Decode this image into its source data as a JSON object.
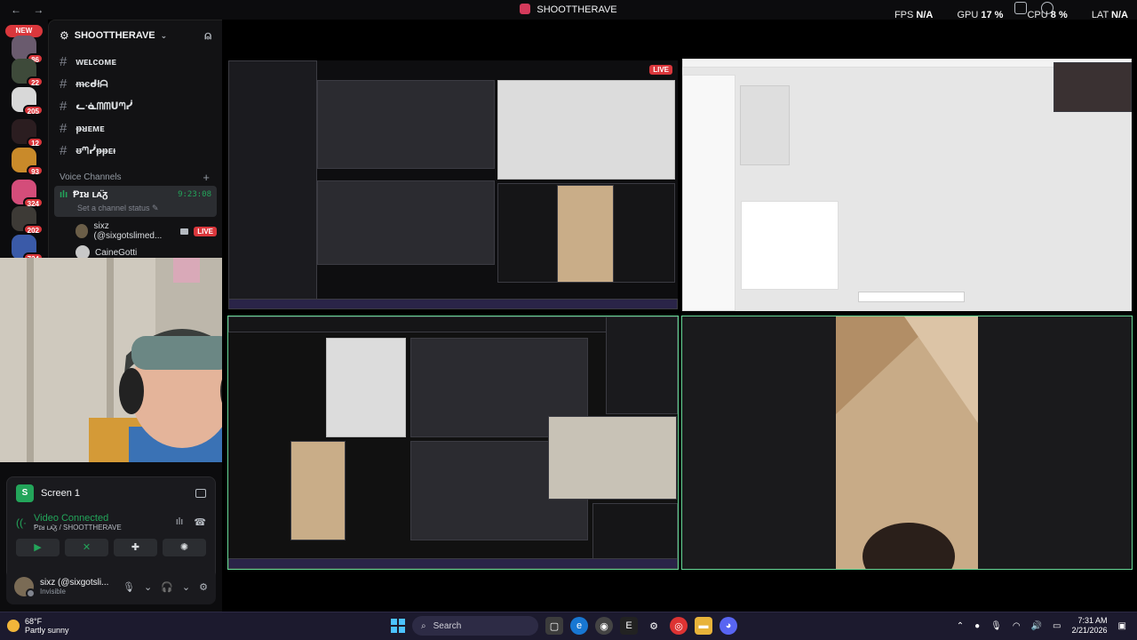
{
  "titlebar": {
    "title": "SHOOTTHERAVE",
    "back": "←",
    "forward": "→"
  },
  "overlay": {
    "fps_label": "FPS",
    "fps_value": "N/A",
    "gpu_label": "GPU",
    "gpu_value": "17 %",
    "cpu_label": "CPU",
    "cpu_value": "8 %",
    "lat_label": "LAT",
    "lat_value": "N/A"
  },
  "rail": {
    "new_label": "NEW",
    "badges": [
      "86",
      "22",
      "205",
      "12",
      "93",
      "324",
      "202",
      "724"
    ]
  },
  "server": {
    "name": "SHOOTTHERAVE",
    "chevron": "⌄",
    "invite": "⍝"
  },
  "channels": [
    {
      "name": "ᴡᴇʟᴄᴏᴍᴇ"
    },
    {
      "name": "ᵯєᑯłᗩ"
    },
    {
      "name": "ᓚᓍᗰᗰᑌᘉᓰ"
    },
    {
      "name": "ᵽᴚᴇᴍᴇ"
    },
    {
      "name": "ᵿᘉᓰᵽᵽᴇᵻ"
    }
  ],
  "voice_category": {
    "label": "Voice Channels",
    "plus": "+"
  },
  "voice_channel": {
    "name": "Ᵽɪᴚ ʟᴀ̈ᵹ",
    "timer": "9:23:08",
    "status": "Set a channel status ✎"
  },
  "voice_users": [
    {
      "name": "sixz (@sixgotslimed...",
      "live": "LIVE",
      "avatar_color": "#6b5e48"
    },
    {
      "name": "CaineGotti",
      "live": "",
      "avatar_color": "#c8c8c8"
    }
  ],
  "stream_panel": {
    "icon_letter": "S",
    "title": "Screen 1",
    "voice_status": "Video Connected",
    "voice_location": "Ᵽɪᴚ ʟᴀ̈ᵹ / SHOOTTHERAVE",
    "buttons": [
      "▶",
      "✕",
      "✚",
      "✺"
    ]
  },
  "user": {
    "name": "sixz (@sixgotsli...",
    "status": "Invisible"
  },
  "stage": {
    "live_label": "LIVE"
  },
  "taskbar": {
    "weather_temp": "68°F",
    "weather_desc": "Partly sunny",
    "search_placeholder": "Search",
    "time": "7:31 AM",
    "date": "2/21/2026",
    "discord_badge": "9+"
  },
  "colors": {
    "accent": "#5865f2",
    "live": "#da373c",
    "online": "#23a55a",
    "tile_border": "#66d796"
  }
}
